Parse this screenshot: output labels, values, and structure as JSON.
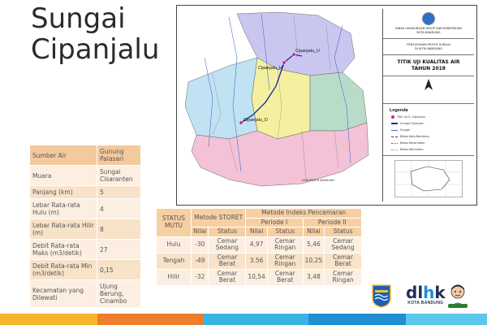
{
  "title": {
    "line1": "Sungai",
    "line2": "Cipanjalu"
  },
  "info_table": [
    {
      "key": "Sumber Air",
      "value": "Gunung Palasari"
    },
    {
      "key": "Muara",
      "value": "Sungai Cisaranten"
    },
    {
      "key": "Panjang (km)",
      "value": "5"
    },
    {
      "key": "Lebar Rata-rata Hulu (m)",
      "value": "4"
    },
    {
      "key": "Lebar Rata-rata Hilir (m)",
      "value": "8"
    },
    {
      "key": "Debit Rata-rata Maks (m3/detik)",
      "value": "27"
    },
    {
      "key": "Debit Rata-rata Min (m3/detik)",
      "value": "0,15"
    },
    {
      "key": "Kecamatan yang Dilewati",
      "value": "Ujung Berung, Cinambo"
    }
  ],
  "map": {
    "header_line1": "DINAS LINGKUNGAN HIDUP DAN KEBERSIHAN",
    "header_line2": "KOTA BANDUNG",
    "subtitle_line1": "PENYUSUNAN PROFIL SUNGAI",
    "subtitle_line2": "DI KOTA BANDUNG",
    "main_title_line1": "TITIK UJI KUALITAS AIR",
    "main_title_line2": "TAHUN 2018",
    "legend_title": "Legenda",
    "legend_items": [
      "Titik Uji S. Cipanjalu",
      "Sungai Cipanjalu",
      "Sungai",
      "Batas Kota Bandung",
      "Batas Kecamatan",
      "Batas Kelurahan"
    ],
    "points": [
      {
        "label": "Cipanjalu_H"
      },
      {
        "label": "Cipanjalu_U"
      },
      {
        "label": "Cipanjalu_D"
      }
    ],
    "region_label": "KABUPATEN BANDUNG",
    "colors": {
      "north": "#c9c7ef",
      "center": "#f5f0a0",
      "east": "#b8dcc8",
      "west": "#c0e2f2",
      "south": "#f4c2d6",
      "river": "#1d2fa3"
    }
  },
  "pollution_table": {
    "headers": {
      "status": "STATUS MUTU",
      "storet": "Metode STORET",
      "ip": "Metode Indeks Pencemaran",
      "p1": "Periode I",
      "p2": "Periode II",
      "nilai": "Nilai",
      "status_col": "Status"
    },
    "rows": [
      {
        "name": "Hulu",
        "storet_val": "-30",
        "storet_status": "Cemar Sedang",
        "p1_val": "4,97",
        "p1_status": "Cemar Ringan",
        "p2_val": "5,46",
        "p2_status": "Cemar Sedang"
      },
      {
        "name": "Tengah",
        "storet_val": "-49",
        "storet_status": "Cemar Berat",
        "p1_val": "3.56",
        "p1_status": "Cemar Ringan",
        "p2_val": "10,25",
        "p2_status": "Cemar Berat"
      },
      {
        "name": "Hilir",
        "storet_val": "-32",
        "storet_status": "Cemar Berat",
        "p1_val": "10,54",
        "p1_status": "Cemar Berat",
        "p2_val": "3,48",
        "p2_status": "Cemar Ringan"
      }
    ]
  },
  "logos": {
    "dlhk_text_a": "dl",
    "dlhk_text_b": "h",
    "dlhk_text_c": "k",
    "dlhk_sub": "KOTA BANDUNG"
  },
  "stripe_colors": [
    "#f7b52c",
    "#ef7d2b",
    "#39b5e5",
    "#1f8fd4",
    "#5bc7ea"
  ]
}
